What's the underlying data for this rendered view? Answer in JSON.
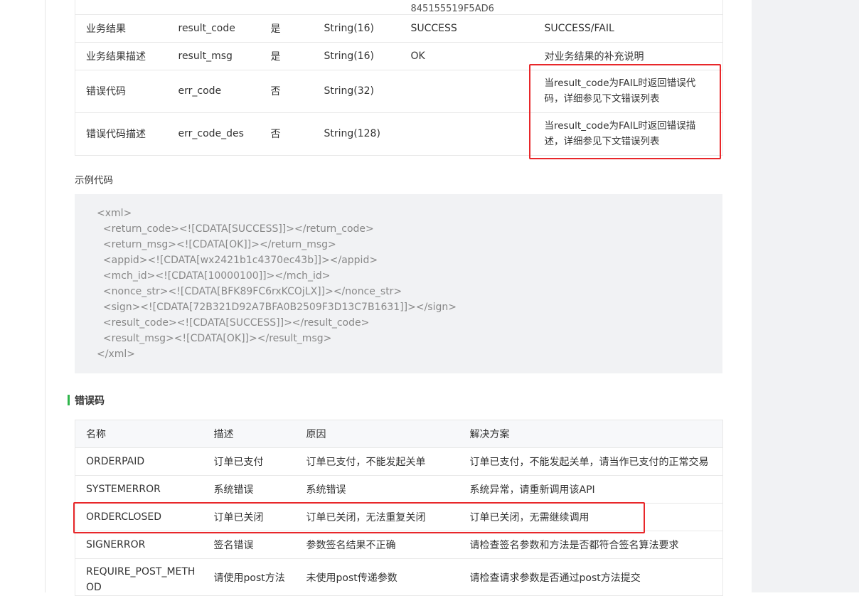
{
  "params_table": {
    "cut_row": {
      "example": "845155519F5AD6"
    },
    "rows": [
      {
        "name": "业务结果",
        "field": "result_code",
        "required": "是",
        "type": "String(16)",
        "example": "SUCCESS",
        "desc": "SUCCESS/FAIL"
      },
      {
        "name": "业务结果描述",
        "field": "result_msg",
        "required": "是",
        "type": "String(16)",
        "example": "OK",
        "desc": "对业务结果的补充说明"
      },
      {
        "name": "错误代码",
        "field": "err_code",
        "required": "否",
        "type": "String(32)",
        "example": "",
        "desc": "当result_code为FAIL时返回错误代码，详细参见下文错误列表"
      },
      {
        "name": "错误代码描述",
        "field": "err_code_des",
        "required": "否",
        "type": "String(128)",
        "example": "",
        "desc": "当result_code为FAIL时返回错误描述，详细参见下文错误列表"
      }
    ]
  },
  "example_label": "示例代码",
  "code_lines": [
    "<xml>",
    "  <return_code><![CDATA[SUCCESS]]></return_code>",
    "  <return_msg><![CDATA[OK]]></return_msg>",
    "  <appid><![CDATA[wx2421b1c4370ec43b]]></appid>",
    "  <mch_id><![CDATA[10000100]]></mch_id>",
    "  <nonce_str><![CDATA[BFK89FC6rxKCOjLX]]></nonce_str>",
    "  <sign><![CDATA[72B321D92A7BFA0B2509F3D13C7B1631]]></sign>",
    "  <result_code><![CDATA[SUCCESS]]></result_code>",
    "  <result_msg><![CDATA[OK]]></result_msg>",
    "</xml>"
  ],
  "error_heading": "错误码",
  "errors_table": {
    "headers": [
      "名称",
      "描述",
      "原因",
      "解决方案"
    ],
    "rows": [
      [
        "ORDERPAID",
        "订单已支付",
        "订单已支付，不能发起关单",
        "订单已支付，不能发起关单，请当作已支付的正常交易"
      ],
      [
        "SYSTEMERROR",
        "系统错误",
        "系统错误",
        "系统异常，请重新调用该API"
      ],
      [
        "ORDERCLOSED",
        "订单已关闭",
        "订单已关闭，无法重复关闭",
        "订单已关闭，无需继续调用"
      ],
      [
        "SIGNERROR",
        "签名错误",
        "参数签名结果不正确",
        "请检查签名参数和方法是否都符合签名算法要求"
      ],
      [
        "REQUIRE_POST_METHOD",
        "请使用post方法",
        "未使用post传递参数",
        "请检查请求参数是否通过post方法提交"
      ]
    ]
  },
  "colors": {
    "highlight_border": "#e8272a",
    "heading_accent": "#2fb54b",
    "code_background": "#f1f2f4",
    "gutter_background": "#f1f2f4"
  }
}
